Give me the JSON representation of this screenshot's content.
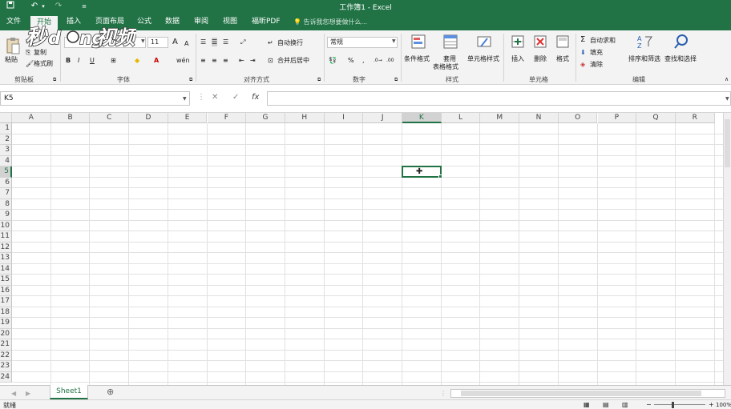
{
  "window": {
    "title": "工作簿1 - Excel"
  },
  "quick_access": {
    "save_icon": "save-icon",
    "undo_icon": "undo-icon",
    "redo_icon": "redo-icon",
    "customize_icon": "customize-qat-icon"
  },
  "menu": {
    "tabs": [
      "文件",
      "开始",
      "插入",
      "页面布局",
      "公式",
      "数据",
      "审阅",
      "视图",
      "福昕PDF"
    ],
    "active_index": 1,
    "tell_me": "告诉我您想要做什么..."
  },
  "watermark": {
    "text": "秒懂视频"
  },
  "ribbon": {
    "clipboard": {
      "paste": "粘贴",
      "cut": "剪切",
      "copy": "复制",
      "format_painter": "格式刷",
      "label": "剪贴板"
    },
    "font": {
      "name": "",
      "size": "11",
      "bold": "B",
      "italic": "I",
      "underline": "U",
      "grow": "A",
      "shrink": "A",
      "label": "字体"
    },
    "alignment": {
      "wrap": "自动换行",
      "merge": "合并后居中",
      "label": "对齐方式"
    },
    "number": {
      "format": "常规",
      "percent": "%",
      "comma": ",",
      "label": "数字"
    },
    "styles": {
      "conditional": "条件格式",
      "table_line1": "套用",
      "table_line2": "表格格式",
      "cell_styles": "单元格样式",
      "label": "样式"
    },
    "cells": {
      "insert": "插入",
      "delete": "删除",
      "format": "格式",
      "label": "单元格"
    },
    "editing": {
      "autosum": "自动求和",
      "fill": "填充",
      "clear": "清除",
      "sort": "排序和筛选",
      "find": "查找和选择",
      "label": "编辑"
    }
  },
  "formula_bar": {
    "name_box": "K5",
    "cancel": "✕",
    "enter": "✓",
    "fx": "fx",
    "value": ""
  },
  "grid": {
    "columns": [
      "A",
      "B",
      "C",
      "D",
      "E",
      "F",
      "G",
      "H",
      "I",
      "J",
      "K",
      "L",
      "M",
      "N",
      "O",
      "P",
      "Q",
      "R"
    ],
    "rows": [
      "1",
      "2",
      "3",
      "4",
      "5",
      "6",
      "7",
      "8",
      "9",
      "10",
      "11",
      "12",
      "13",
      "14",
      "15",
      "16",
      "17",
      "18",
      "19",
      "20",
      "21",
      "22",
      "23",
      "24"
    ],
    "active_cell": "K5",
    "active_col": "K",
    "active_row": "5"
  },
  "sheets": {
    "tabs": [
      "Sheet1"
    ],
    "active": "Sheet1",
    "add_icon": "plus-circle-icon"
  },
  "status": {
    "mode": "就绪",
    "zoom": "100%"
  },
  "colors": {
    "accent": "#217346",
    "ribbon_bg": "#f3f3f3",
    "grid_line": "#e1e1e1"
  }
}
